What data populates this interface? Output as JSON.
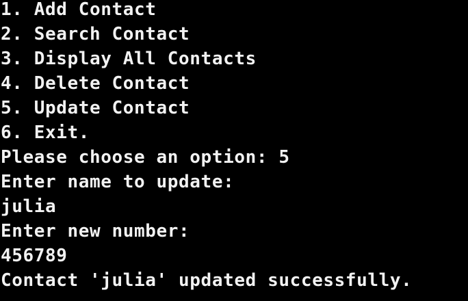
{
  "terminal": {
    "lines": [
      "1. Add Contact",
      "2. Search Contact",
      "3. Display All Contacts",
      "4. Delete Contact",
      "5. Update Contact",
      "6. Exit.",
      "Please choose an option: 5",
      "Enter name to update:",
      "julia",
      "Enter new number:",
      "456789",
      "Contact 'julia' updated successfully."
    ]
  },
  "colors": {
    "background": "#000000",
    "text": "#f2f2f2"
  }
}
